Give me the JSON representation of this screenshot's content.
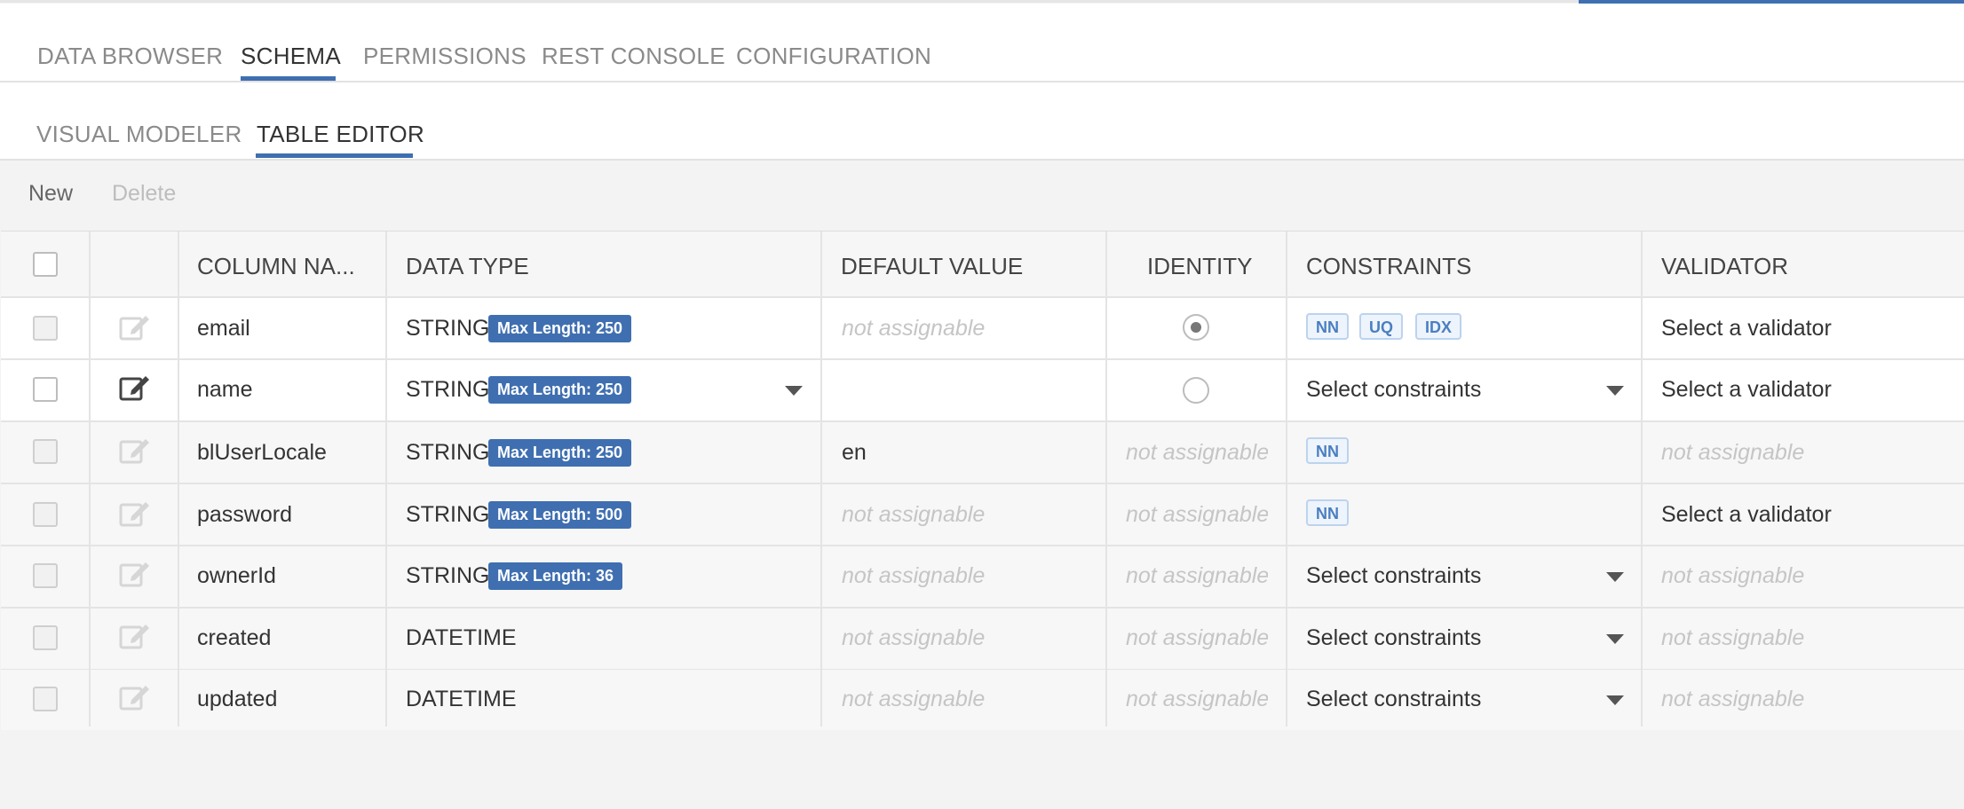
{
  "main_tabs": [
    "DATA BROWSER",
    "SCHEMA",
    "PERMISSIONS",
    "REST CONSOLE",
    "CONFIGURATION"
  ],
  "sub_tabs": [
    "VISUAL MODELER",
    "TABLE EDITOR"
  ],
  "toolbar": {
    "new_label": "New",
    "delete_label": "Delete"
  },
  "table": {
    "headers": {
      "column_name": "COLUMN NA...",
      "data_type": "DATA TYPE",
      "default_value": "DEFAULT VALUE",
      "identity": "IDENTITY",
      "constraints": "CONSTRAINTS",
      "validator": "VALIDATOR"
    },
    "rows": [
      {
        "name": "email",
        "type": "STRING",
        "badge": "Max Length: 250",
        "default": "not assignable",
        "identity": "selected radio",
        "constraints_tags": [
          "NN",
          "UQ",
          "IDX"
        ],
        "validator": "Select a validator"
      },
      {
        "name": "name",
        "type": "STRING",
        "badge": "Max Length: 250",
        "default": "",
        "identity": "empty radio",
        "constraints": "Select constraints",
        "validator": "Select a validator"
      },
      {
        "name": "blUserLocale",
        "type": "STRING",
        "badge": "Max Length: 250",
        "default": "en",
        "identity": "not assignable",
        "constraints_tags": [
          "NN"
        ],
        "validator": "not assignable"
      },
      {
        "name": "password",
        "type": "STRING",
        "badge": "Max Length: 500",
        "default": "not assignable",
        "identity": "not assignable",
        "constraints_tags": [
          "NN"
        ],
        "validator": "Select a validator"
      },
      {
        "name": "ownerId",
        "type": "STRING",
        "badge": "Max Length: 36",
        "default": "not assignable",
        "identity": "not assignable",
        "constraints": "Select constraints",
        "validator": "not assignable"
      },
      {
        "name": "created",
        "type": "DATETIME",
        "default": "not assignable",
        "identity": "not assignable",
        "constraints": "Select constraints",
        "validator": "not assignable"
      },
      {
        "name": "updated",
        "type": "DATETIME",
        "default": "not assignable",
        "identity": "not assignable",
        "constraints": "Select constraints",
        "validator": "not assignable"
      }
    ]
  },
  "colors": {
    "accent": "#3f6fb0",
    "tag_text": "#4a7fc1",
    "placeholder": "#c5c5c5"
  },
  "icons": {
    "edit": "edit-icon",
    "dropdown": "caret-down-icon"
  }
}
